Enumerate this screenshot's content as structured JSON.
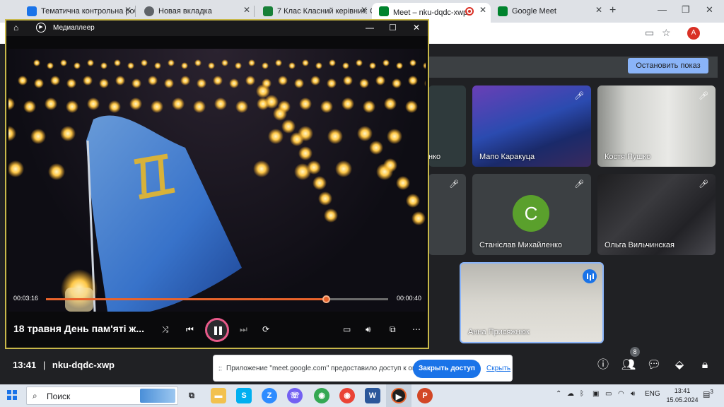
{
  "browser": {
    "tabs": [
      {
        "label": "Тематична контрольна роб",
        "icon": "snowflake-icon",
        "color": "#1a73e8"
      },
      {
        "label": "Новая вкладка",
        "icon": "chrome-icon",
        "color": "#5f6368"
      },
      {
        "label": "7 Клас Класний керівник: С",
        "icon": "classroom-icon",
        "color": "#188038"
      },
      {
        "label": "Meet – nku-dqdc-xwp",
        "icon": "meet-icon",
        "color": "#00832d",
        "active": true
      },
      {
        "label": "Google Meet",
        "icon": "meet-icon",
        "color": "#00832d"
      }
    ],
    "profile_initial": "A"
  },
  "meet": {
    "stop_share_label": "Остановить показ",
    "participants": [
      {
        "name": "нко"
      },
      {
        "name": "Мапо Каракуца"
      },
      {
        "name": "Костя Пушко"
      },
      {
        "name": "Станіслав Михайленко",
        "initial": "С"
      },
      {
        "name": "Ольга Вильчинская"
      },
      {
        "name": "Анна Присяжнюк"
      }
    ],
    "time": "13:41",
    "meeting_code": "nku-dqdc-xwp",
    "participant_count": "8",
    "share_notice": {
      "message": "Приложение \"meet.google.com\" предоставило доступ к окну.",
      "close_label": "Закрыть доступ",
      "hide_label": "Скрыть"
    }
  },
  "player": {
    "title": "Медиаплеер",
    "current_time": "00:03:16",
    "total_time": "00:00:40",
    "progress_fraction": 0.82,
    "track_title": "18 травня День пам'яті ж..."
  },
  "taskbar": {
    "search_label": "Поиск",
    "language": "ENG",
    "clock_time": "13:41",
    "clock_date": "15.05.2024",
    "notification_count": "3"
  }
}
